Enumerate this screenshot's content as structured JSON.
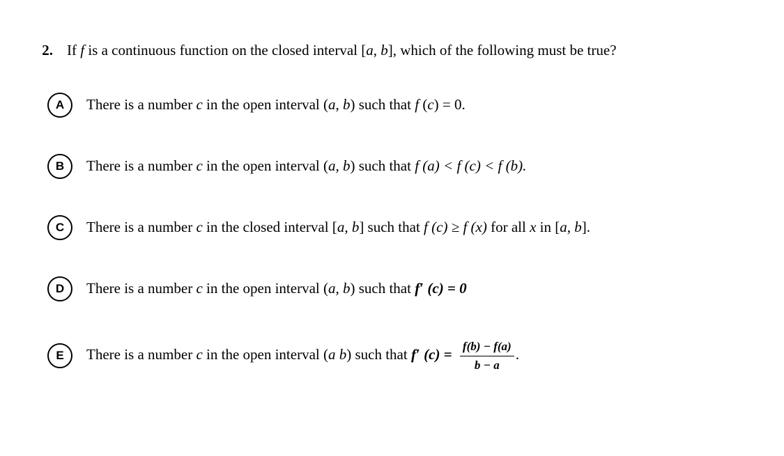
{
  "question": {
    "number": "2.",
    "text_prefix": "If ",
    "text_f": "f",
    "text_mid1": " is a continuous function on the closed interval [",
    "text_a": "a",
    "text_comma1": ", ",
    "text_b": "b",
    "text_suffix": "], which of the following must be true?"
  },
  "options": [
    {
      "letter": "A",
      "prefix": "There is a number ",
      "var_c": "c",
      "mid1": " in the open interval (",
      "var_a": "a",
      "comma": ", ",
      "var_b": "b",
      "mid2": ") such that ",
      "expr_f": "f",
      "expr_paren_open": " (",
      "expr_c": "c",
      "expr_paren_close": ")",
      "expr_eq": " = 0.",
      "type": "simple_fc0"
    },
    {
      "letter": "B",
      "prefix": "There is a number ",
      "var_c": "c",
      "mid1": " in the open interval (",
      "var_a": "a",
      "comma": ", ",
      "var_b": "b",
      "mid2": ") such that ",
      "expr": "f (a) < f (c) < f (b).",
      "type": "inequality"
    },
    {
      "letter": "C",
      "prefix": "There is a number ",
      "var_c": "c",
      "mid1": " in the closed interval [",
      "var_a": "a",
      "comma": ", ",
      "var_b": "b",
      "mid2": "] such that ",
      "expr": "f (c) ≥ f (x)",
      "suffix": " for all ",
      "var_x": "x",
      "suffix2": " in [",
      "var_a2": "a",
      "comma2": ", ",
      "var_b2": "b",
      "suffix3": "].",
      "type": "max"
    },
    {
      "letter": "D",
      "prefix": "There is a number ",
      "var_c": "c",
      "mid1": " in the open interval (",
      "var_a": "a",
      "comma": ", ",
      "var_b": "b",
      "mid2": ") such that ",
      "expr_f": "f",
      "expr_prime": "′",
      "expr_paren": " (c) = 0",
      "type": "prime_zero"
    },
    {
      "letter": "E",
      "prefix": "There is a number ",
      "var_c": "c",
      "mid1": " in the open interval (",
      "var_a": "a",
      "space": " ",
      "var_b": "b",
      "mid2": ") such that ",
      "expr_f": "f",
      "expr_prime": "′",
      "expr_paren": " (c) = ",
      "frac_num": "f(b) − f(a)",
      "frac_den": "b − a",
      "suffix": ".",
      "type": "mvt"
    }
  ]
}
